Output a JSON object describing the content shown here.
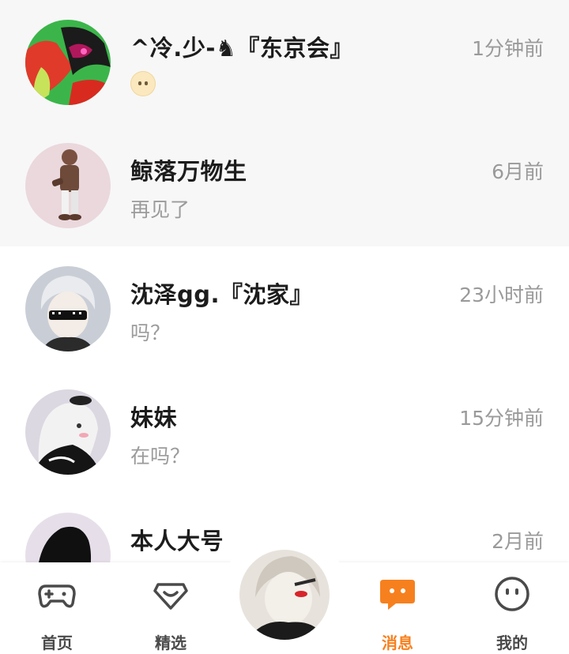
{
  "conversations": [
    {
      "name": "^冷.少-♞『东京会』",
      "preview": "",
      "preview_emoji": "neutral-face-emoji",
      "time": "1分钟前",
      "pinned": true
    },
    {
      "name": "鲸落万物生",
      "preview": "再见了",
      "time": "6月前",
      "pinned": true
    },
    {
      "name": "沈泽gg.『沈家』",
      "preview": "吗？",
      "time": "23小时前",
      "pinned": false
    },
    {
      "name": "妹妹",
      "preview": "在吗？",
      "time": "15分钟前",
      "pinned": false
    },
    {
      "name": "本人大号",
      "preview": "",
      "time": "2月前",
      "pinned": false
    }
  ],
  "tabbar": {
    "home": "首页",
    "featured": "精选",
    "messages": "消息",
    "mine": "我的",
    "active": "messages",
    "active_color": "#f7801e"
  }
}
